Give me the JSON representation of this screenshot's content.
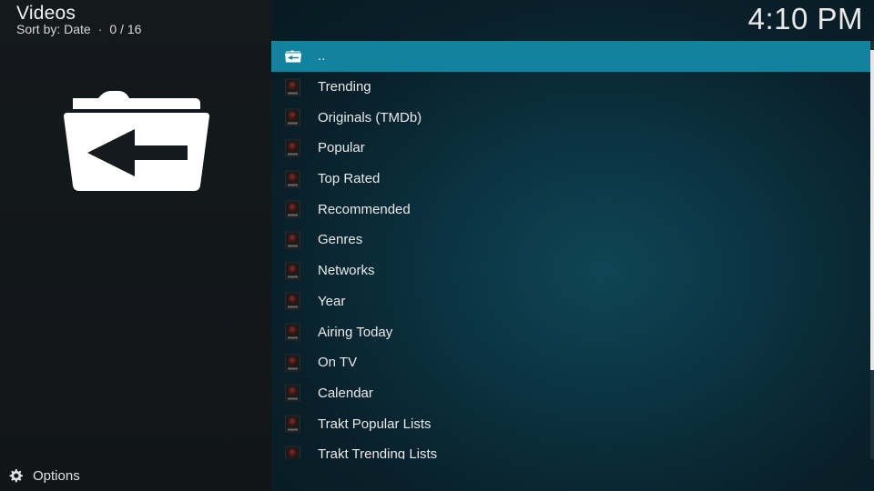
{
  "header": {
    "title": "Videos",
    "sort_label": "Sort by: Date",
    "count": "0 / 16",
    "separator": "·"
  },
  "clock": {
    "time": "4:10 PM"
  },
  "big_icon": {
    "name": "folder-back-icon"
  },
  "list": {
    "items": [
      {
        "label": "..",
        "icon": "folder-back-icon",
        "selected": true
      },
      {
        "label": "Trending",
        "icon": "addon-thumbnail-icon"
      },
      {
        "label": "Originals (TMDb)",
        "icon": "addon-thumbnail-icon"
      },
      {
        "label": "Popular",
        "icon": "addon-thumbnail-icon"
      },
      {
        "label": "Top Rated",
        "icon": "addon-thumbnail-icon"
      },
      {
        "label": "Recommended",
        "icon": "addon-thumbnail-icon"
      },
      {
        "label": "Genres",
        "icon": "addon-thumbnail-icon"
      },
      {
        "label": "Networks",
        "icon": "addon-thumbnail-icon"
      },
      {
        "label": "Year",
        "icon": "addon-thumbnail-icon"
      },
      {
        "label": "Airing Today",
        "icon": "addon-thumbnail-icon"
      },
      {
        "label": "On TV",
        "icon": "addon-thumbnail-icon"
      },
      {
        "label": "Calendar",
        "icon": "addon-thumbnail-icon"
      },
      {
        "label": "Trakt Popular Lists",
        "icon": "addon-thumbnail-icon"
      },
      {
        "label": "Trakt Trending Lists",
        "icon": "addon-thumbnail-icon"
      }
    ]
  },
  "footer": {
    "options_label": "Options",
    "options_icon": "gear-icon"
  },
  "colors": {
    "selected_row": "#12839f",
    "left_panel": "#14191c",
    "right_panel": "#0b3341"
  }
}
